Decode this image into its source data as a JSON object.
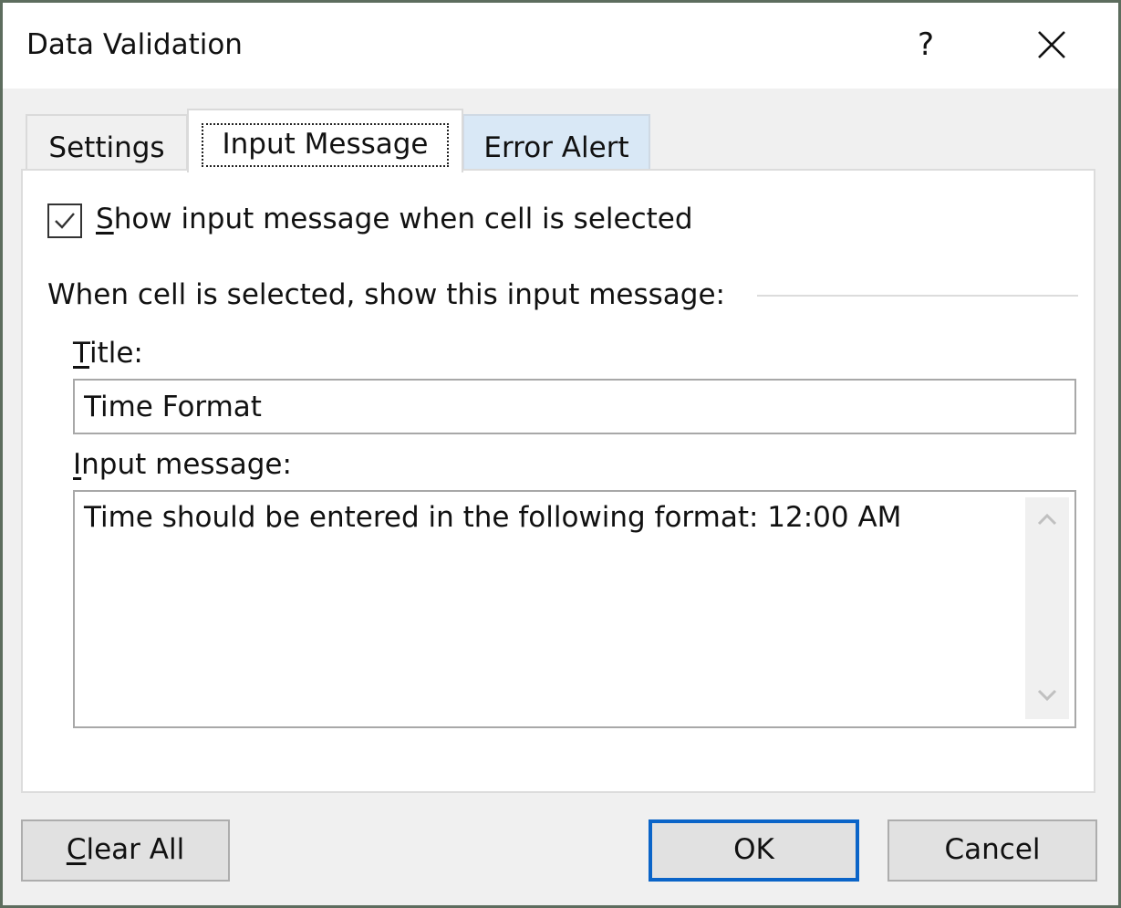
{
  "window": {
    "title": "Data Validation",
    "help_label": "?",
    "close_icon": "close-icon"
  },
  "tabs": [
    {
      "label": "Settings",
      "active": false
    },
    {
      "label": "Input Message",
      "active": true
    },
    {
      "label": "Error Alert",
      "active": false
    }
  ],
  "input_message": {
    "show_checkbox": {
      "checked": true,
      "label_accel": "S",
      "label_rest": "how input message when cell is selected"
    },
    "group_label": "When cell is selected, show this input message:",
    "title_label_accel": "T",
    "title_label_rest": "itle:",
    "title_value": "Time Format",
    "message_label_accel": "I",
    "message_label_rest": "nput message:",
    "message_value": "Time should be entered in the following format: 12:00 AM"
  },
  "buttons": {
    "clear_all_accel": "C",
    "clear_all_rest": "lear All",
    "ok": "OK",
    "cancel": "Cancel"
  },
  "colors": {
    "default_button_border": "#0a64c8",
    "inactive_tab_hover": "#d9e8f6",
    "dialog_background": "#f0f0f0"
  }
}
